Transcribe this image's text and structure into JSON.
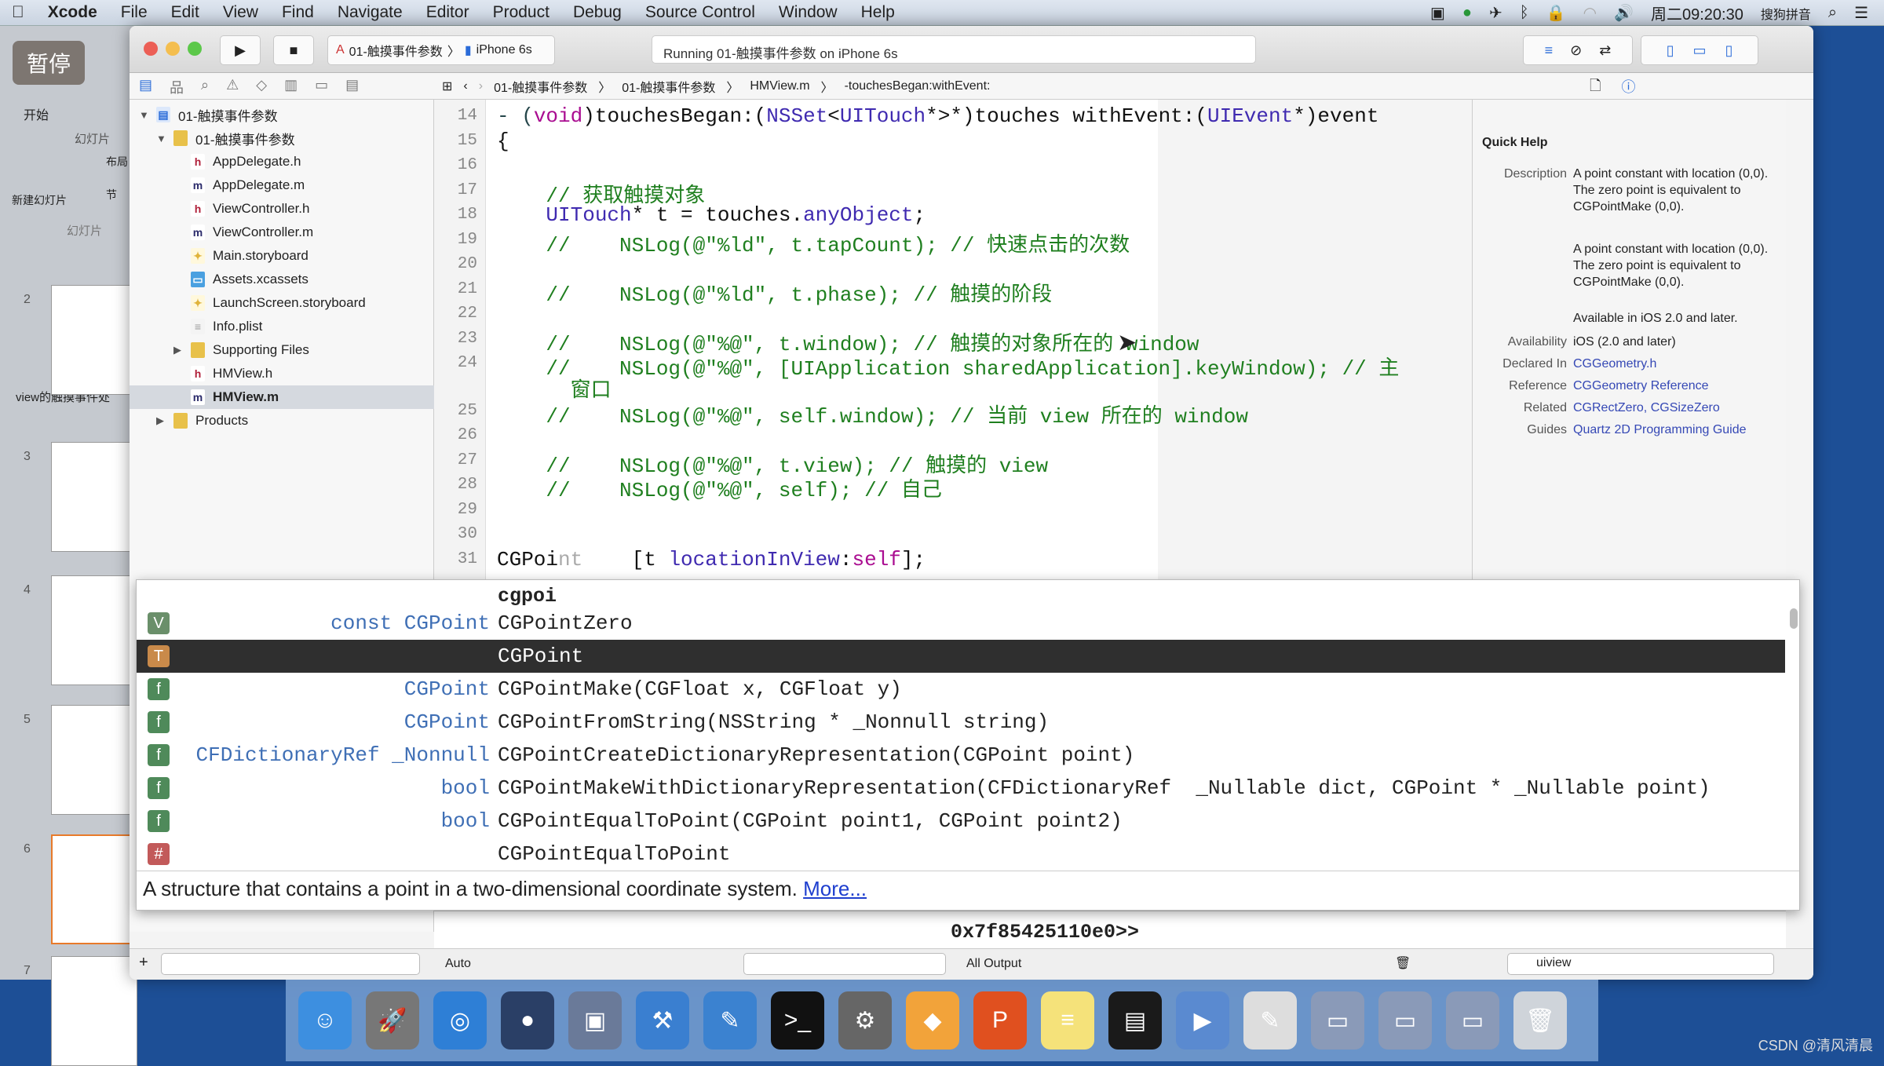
{
  "menubar": {
    "app": "Xcode",
    "items": [
      "File",
      "Edit",
      "View",
      "Find",
      "Navigate",
      "Editor",
      "Product",
      "Debug",
      "Source Control",
      "Window",
      "Help"
    ],
    "clock": "周二09:20:30",
    "ime": "搜狗拼音"
  },
  "overlay": {
    "pause_label": "暂停"
  },
  "ppt": {
    "tab": "开始",
    "group": "幻灯片",
    "new_slide": "新建幻灯片",
    "layout": "布局",
    "section": "节",
    "panel_tab": "幻灯片",
    "section_title": "view的触摸事件处",
    "slide_numbers": [
      "2",
      "3",
      "4",
      "5",
      "6",
      "7"
    ]
  },
  "toolbar": {
    "scheme": "01-触摸事件参数",
    "device": "iPhone 6s",
    "status": "Running 01-触摸事件参数 on iPhone 6s"
  },
  "jumpbar": {
    "crumbs": [
      "01-触摸事件参数",
      "01-触摸事件参数",
      "HMView.m",
      "-touchesBegan:withEvent:"
    ]
  },
  "navigator": {
    "items": [
      {
        "label": "01-触摸事件参数",
        "kind": "project",
        "level": 0,
        "disclosure": "▼"
      },
      {
        "label": "01-触摸事件参数",
        "kind": "folder",
        "level": 1,
        "disclosure": "▼"
      },
      {
        "label": "AppDelegate.h",
        "kind": "h",
        "level": 2
      },
      {
        "label": "AppDelegate.m",
        "kind": "m",
        "level": 2
      },
      {
        "label": "ViewController.h",
        "kind": "h",
        "level": 2
      },
      {
        "label": "ViewController.m",
        "kind": "m",
        "level": 2
      },
      {
        "label": "Main.storyboard",
        "kind": "storyboard",
        "level": 2
      },
      {
        "label": "Assets.xcassets",
        "kind": "assets",
        "level": 2
      },
      {
        "label": "LaunchScreen.storyboard",
        "kind": "storyboard",
        "level": 2
      },
      {
        "label": "Info.plist",
        "kind": "plist",
        "level": 2
      },
      {
        "label": "Supporting Files",
        "kind": "folder",
        "level": 2,
        "disclosure": "▶"
      },
      {
        "label": "HMView.h",
        "kind": "h",
        "level": 2
      },
      {
        "label": "HMView.m",
        "kind": "m",
        "level": 2,
        "selected": true
      },
      {
        "label": "Products",
        "kind": "folder",
        "level": 1,
        "disclosure": "▶"
      }
    ]
  },
  "code": {
    "lines": [
      {
        "n": "14",
        "t": [
          [
            "- (",
            "mt"
          ],
          [
            "void",
            "kw"
          ],
          [
            ")touchesBegan:(",
            ""
          ],
          [
            "NSSet",
            "ty"
          ],
          [
            "<",
            ""
          ],
          [
            "UITouch",
            "ty"
          ],
          [
            "*>*)touches withEvent:(",
            ""
          ],
          [
            "UIEvent",
            "ty"
          ],
          [
            "*)event",
            ""
          ]
        ]
      },
      {
        "n": "15",
        "t": [
          [
            "{",
            ""
          ]
        ]
      },
      {
        "n": "16",
        "t": []
      },
      {
        "n": "17",
        "t": [
          [
            "    // 获取触摸对象",
            "cm"
          ]
        ]
      },
      {
        "n": "18",
        "t": [
          [
            "    ",
            ""
          ],
          [
            "UITouch",
            "ty"
          ],
          [
            "* t = touches.",
            ""
          ],
          [
            "anyObject",
            "ty"
          ],
          [
            ";",
            ""
          ]
        ]
      },
      {
        "n": "19",
        "t": [
          [
            "    //    NSLog(@\"%ld\", t.tapCount); // 快速点击的次数",
            "cm"
          ]
        ]
      },
      {
        "n": "20",
        "t": []
      },
      {
        "n": "21",
        "t": [
          [
            "    //    NSLog(@\"%ld\", t.phase); // 触摸的阶段",
            "cm"
          ]
        ]
      },
      {
        "n": "22",
        "t": []
      },
      {
        "n": "23",
        "t": [
          [
            "    //    NSLog(@\"%@\", t.window); // 触摸的对象所在的 window",
            "cm"
          ]
        ]
      },
      {
        "n": "24",
        "t": [
          [
            "    //    NSLog(@\"%@\", [UIApplication sharedApplication].keyWindow); // 主",
            "cm"
          ]
        ],
        "wrap": "      窗口"
      },
      {
        "n": "25",
        "t": [
          [
            "    //    NSLog(@\"%@\", self.window); // 当前 view 所在的 window",
            "cm"
          ]
        ]
      },
      {
        "n": "26",
        "t": []
      },
      {
        "n": "27",
        "t": [
          [
            "    //    NSLog(@\"%@\", t.view); // 触摸的 view",
            "cm"
          ]
        ]
      },
      {
        "n": "28",
        "t": [
          [
            "    //    NSLog(@\"%@\", self); // 自己",
            "cm"
          ]
        ]
      },
      {
        "n": "29",
        "t": []
      },
      {
        "n": "30",
        "t": []
      },
      {
        "n": "31",
        "t": [
          [
            "CGPoi",
            ""
          ],
          [
            "nt",
            "gh"
          ],
          [
            "    [t ",
            ""
          ],
          [
            "locationInView",
            "ty"
          ],
          [
            ":",
            ""
          ],
          [
            "self",
            "kw"
          ],
          [
            "];",
            ""
          ]
        ]
      }
    ]
  },
  "autocomplete": {
    "filter": "cgpoi",
    "items": [
      {
        "badge": "V",
        "badge_color": "#6a8f6a",
        "type": "const CGPoint",
        "name": "CGPointZero"
      },
      {
        "badge": "T",
        "badge_color": "#c98a4a",
        "type": "",
        "name": "CGPoint",
        "selected": true
      },
      {
        "badge": "f",
        "badge_color": "#4f8a5a",
        "type": "CGPoint",
        "name": "CGPointMake(CGFloat x, CGFloat y)"
      },
      {
        "badge": "f",
        "badge_color": "#4f8a5a",
        "type": "CGPoint",
        "name": "CGPointFromString(NSString * _Nonnull string)"
      },
      {
        "badge": "f",
        "badge_color": "#4f8a5a",
        "type": "CFDictionaryRef _Nonnull",
        "name": "CGPointCreateDictionaryRepresentation(CGPoint point)"
      },
      {
        "badge": "f",
        "badge_color": "#4f8a5a",
        "type": "bool",
        "name": "CGPointMakeWithDictionaryRepresentation(CFDictionaryRef  _Nullable dict, CGPoint * _Nullable point)"
      },
      {
        "badge": "f",
        "badge_color": "#4f8a5a",
        "type": "bool",
        "name": "CGPointEqualToPoint(CGPoint point1, CGPoint point2)"
      },
      {
        "badge": "#",
        "badge_color": "#c25a5a",
        "type": "",
        "name": "CGPointEqualToPoint"
      }
    ],
    "description": "A structure that contains a point in a two-dimensional coordinate system.",
    "more": "More..."
  },
  "quickhelp": {
    "title": "Quick Help",
    "rows": [
      {
        "label": "Description",
        "value": "A point constant with location (0,0). The zero point is equivalent to CGPointMake (0,0)."
      },
      {
        "label": "",
        "value": "A point constant with location (0,0). The zero point is equivalent to CGPointMake (0,0)."
      },
      {
        "label": "",
        "value": "Available in iOS 2.0 and later."
      },
      {
        "label": "Availability",
        "value": "iOS (2.0 and later)"
      },
      {
        "label": "Declared In",
        "value": "CGGeometry.h",
        "link": true
      },
      {
        "label": "Reference",
        "value": "CGGeometry Reference",
        "link": true
      },
      {
        "label": "Related",
        "value": "CGRectZero, CGSizeZero",
        "link": true
      },
      {
        "label": "Guides",
        "value": "Quartz 2D Programming Guide",
        "link": true
      }
    ]
  },
  "debug": {
    "console_text": "0x7f85425110e0>>",
    "variables_mode": "Auto",
    "output_mode": "All Output",
    "filter_value": "uiview"
  },
  "dock": {
    "icons": [
      {
        "name": "finder",
        "color": "#3d8fe0",
        "glyph": "☺"
      },
      {
        "name": "launchpad",
        "color": "#777",
        "glyph": "🚀"
      },
      {
        "name": "safari",
        "color": "#2e7fd6",
        "glyph": "◎"
      },
      {
        "name": "mouse-app",
        "color": "#2a3f66",
        "glyph": "●"
      },
      {
        "name": "photo-slideshow",
        "color": "#6a7a99",
        "glyph": "▣"
      },
      {
        "name": "xcode",
        "color": "#3a7fd0",
        "glyph": "⚒"
      },
      {
        "name": "instruments",
        "color": "#3b82d0",
        "glyph": "✎"
      },
      {
        "name": "terminal",
        "color": "#111",
        "glyph": ">_"
      },
      {
        "name": "system-preferences",
        "color": "#666",
        "glyph": "⚙"
      },
      {
        "name": "sketch",
        "color": "#f2a33a",
        "glyph": "◆"
      },
      {
        "name": "paw",
        "color": "#e0501f",
        "glyph": "P"
      },
      {
        "name": "notes",
        "color": "#f5e27a",
        "glyph": "≡"
      },
      {
        "name": "console",
        "color": "#1a1a1a",
        "glyph": "▤"
      },
      {
        "name": "quicktime-player",
        "color": "#5a8ad0",
        "glyph": "▶"
      },
      {
        "name": "preview",
        "color": "#ddd",
        "glyph": "✎"
      },
      {
        "name": "screen-share-1",
        "color": "#8a9ab8",
        "glyph": "▭"
      },
      {
        "name": "screen-share-2",
        "color": "#8a9ab8",
        "glyph": "▭"
      },
      {
        "name": "screen-share-3",
        "color": "#8a9ab8",
        "glyph": "▭"
      },
      {
        "name": "trash",
        "color": "#cfd4da",
        "glyph": "🗑"
      }
    ]
  },
  "watermark": "CSDN @清风清晨"
}
